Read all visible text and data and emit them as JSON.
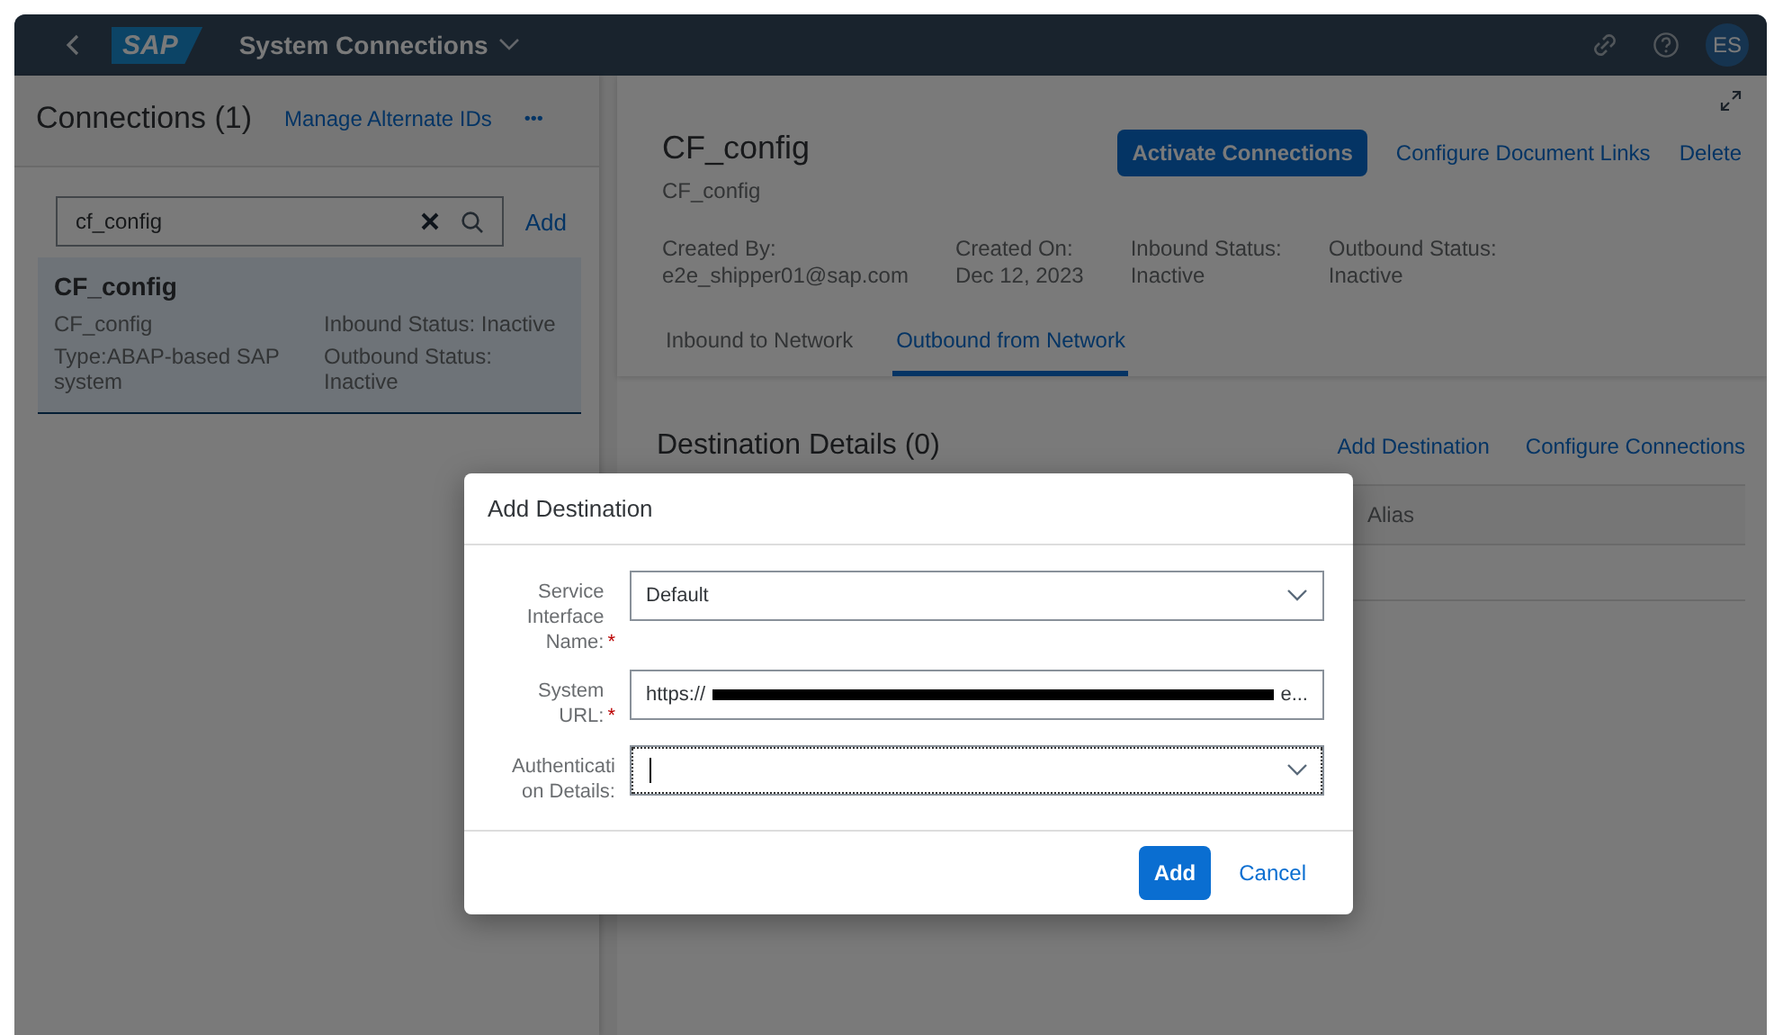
{
  "shell": {
    "logo": "SAP",
    "title": "System Connections",
    "avatar": "ES"
  },
  "list_panel": {
    "title": "Connections (1)",
    "manage_link": "Manage Alternate IDs",
    "more": "•••",
    "search": {
      "value": "cf_config"
    },
    "add": "Add",
    "items": [
      {
        "name": "CF_config",
        "id": "CF_config",
        "type": "Type:ABAP-based SAP system",
        "inbound": "Inbound Status: Inactive",
        "outbound": "Outbound Status: Inactive",
        "selected": true
      }
    ]
  },
  "detail": {
    "title": "CF_config",
    "subtitle": "CF_config",
    "actions": [
      {
        "label": "Activate Connections",
        "kind": "primary"
      },
      {
        "label": "Configure Document Links",
        "kind": "link"
      },
      {
        "label": "Delete",
        "kind": "link"
      }
    ],
    "attributes": [
      {
        "label": "Created By:",
        "value": "e2e_shipper01@sap.com"
      },
      {
        "label": "Created On:",
        "value": "Dec 12, 2023"
      },
      {
        "label": "Inbound Status:",
        "value": "Inactive"
      },
      {
        "label": "Outbound Status:",
        "value": "Inactive"
      }
    ],
    "tabs": [
      {
        "label": "Inbound to Network",
        "selected": false
      },
      {
        "label": "Outbound from Network",
        "selected": true
      }
    ],
    "section_title": "Destination Details (0)",
    "section_actions": [
      "Add Destination",
      "Configure Connections"
    ],
    "table_columns": [
      "Alias"
    ]
  },
  "dialog": {
    "title": "Add Destination",
    "fields": [
      {
        "label": "Service Interface Name:",
        "required": true,
        "required_mark": "*",
        "kind": "select",
        "value": "Default",
        "focused": false
      },
      {
        "label": "System URL:",
        "required": true,
        "required_mark": "*",
        "kind": "text",
        "value": "https://",
        "redacted": true,
        "value_end": "e...",
        "focused": false
      },
      {
        "label": "Authentication Details:",
        "required": false,
        "kind": "select",
        "focused": true
      }
    ],
    "buttons": [
      {
        "label": "Add",
        "kind": "primary"
      },
      {
        "label": "Cancel",
        "kind": "link"
      }
    ]
  }
}
